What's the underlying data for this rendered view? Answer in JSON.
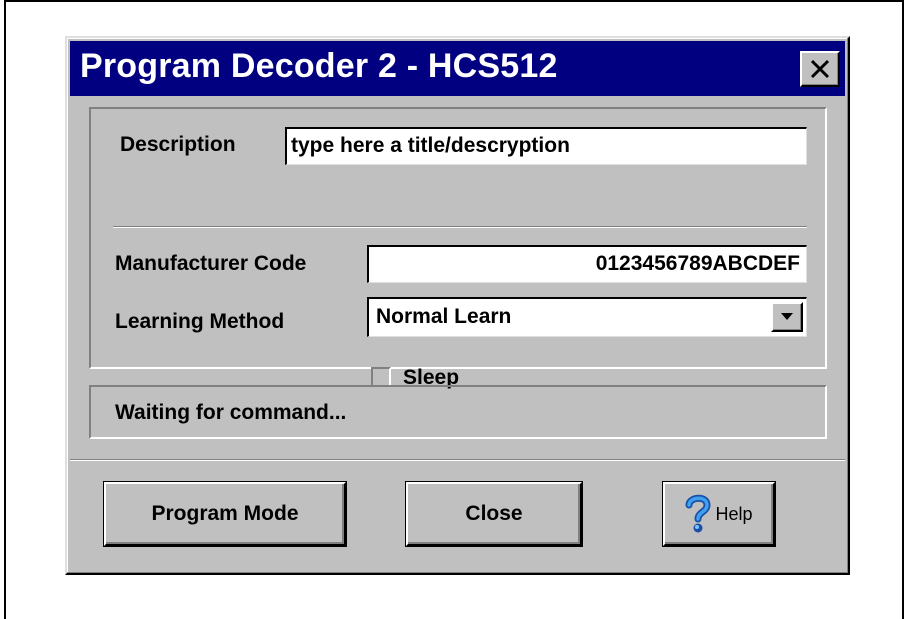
{
  "window": {
    "title": "Program Decoder 2 - HCS512",
    "close_icon": "close-x-icon"
  },
  "form": {
    "description_label": "Description",
    "description_value": "type here a title/descryption",
    "manufacturer_code_label": "Manufacturer Code",
    "manufacturer_code_value": "0123456789ABCDEF",
    "learning_method_label": "Learning Method",
    "learning_method_value": "Normal Learn",
    "sleep_label": "Sleep",
    "sleep_checked": false
  },
  "status": {
    "text": "Waiting for command..."
  },
  "buttons": {
    "program_mode_label": "Program Mode",
    "close_label": "Close",
    "help_label": "Help",
    "help_icon": "question-mark-icon"
  },
  "colors": {
    "titlebar": "#000080",
    "dialog_face": "#c0c0c0",
    "help_icon": "#2a6fd6"
  }
}
